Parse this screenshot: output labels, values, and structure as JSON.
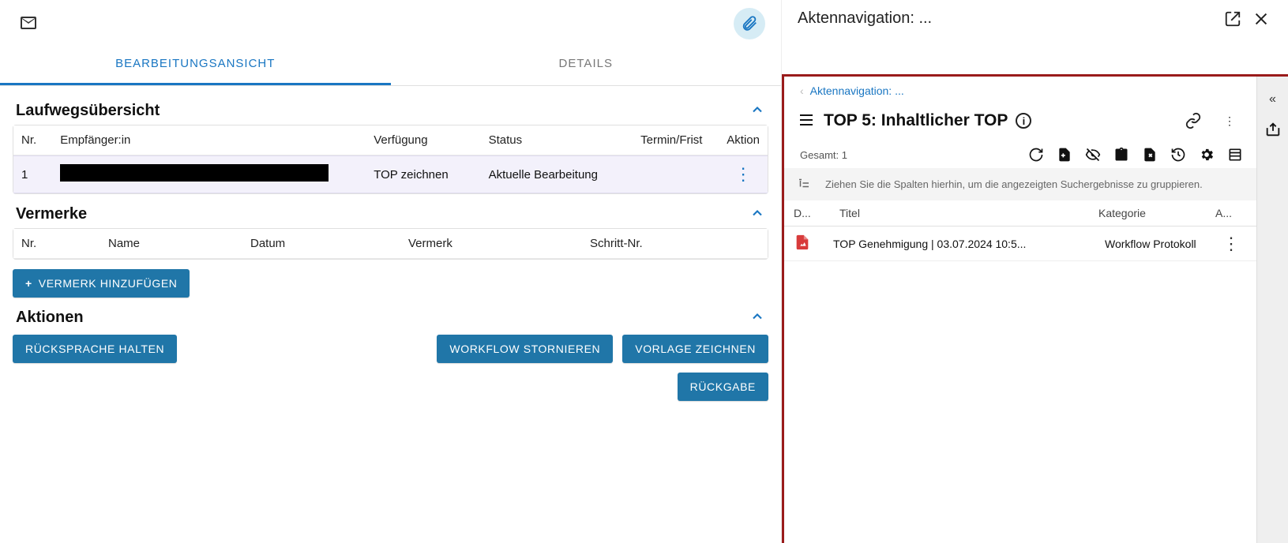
{
  "header": {
    "right_panel_title": "Aktennavigation: ..."
  },
  "tabs": {
    "edit": "BEARBEITUNGSANSICHT",
    "details": "DETAILS"
  },
  "sections": {
    "laufweg": {
      "title": "Laufwegsübersicht",
      "cols": {
        "nr": "Nr.",
        "empf": "Empfänger:in",
        "verf": "Verfügung",
        "status": "Status",
        "termin": "Termin/Frist",
        "aktion": "Aktion"
      },
      "row": {
        "nr": "1",
        "verf": "TOP zeichnen",
        "status": "Aktuelle Bearbeitung",
        "termin": ""
      }
    },
    "vermerke": {
      "title": "Vermerke",
      "cols": {
        "nr": "Nr.",
        "name": "Name",
        "datum": "Datum",
        "vermerk": "Vermerk",
        "schritt": "Schritt-Nr."
      },
      "add_btn": "VERMERK HINZUFÜGEN"
    },
    "aktionen": {
      "title": "Aktionen",
      "ruecksprache": "RÜCKSPRACHE HALTEN",
      "storno": "WORKFLOW STORNIEREN",
      "vorlage": "VORLAGE ZEICHNEN",
      "rueckgabe": "RÜCKGABE"
    }
  },
  "right": {
    "breadcrumb": "Aktennavigation: ...",
    "node_title": "TOP 5: Inhaltlicher TOP",
    "total_label": "Gesamt: 1",
    "group_hint": "Ziehen Sie die Spalten hierhin, um die angezeigten Suchergebnisse zu gruppieren.",
    "cols": {
      "d": "D...",
      "titel": "Titel",
      "kat": "Kategorie",
      "a": "A..."
    },
    "row": {
      "titel": "TOP Genehmigung | 03.07.2024 10:5...",
      "kat": "Workflow Protokoll"
    }
  }
}
